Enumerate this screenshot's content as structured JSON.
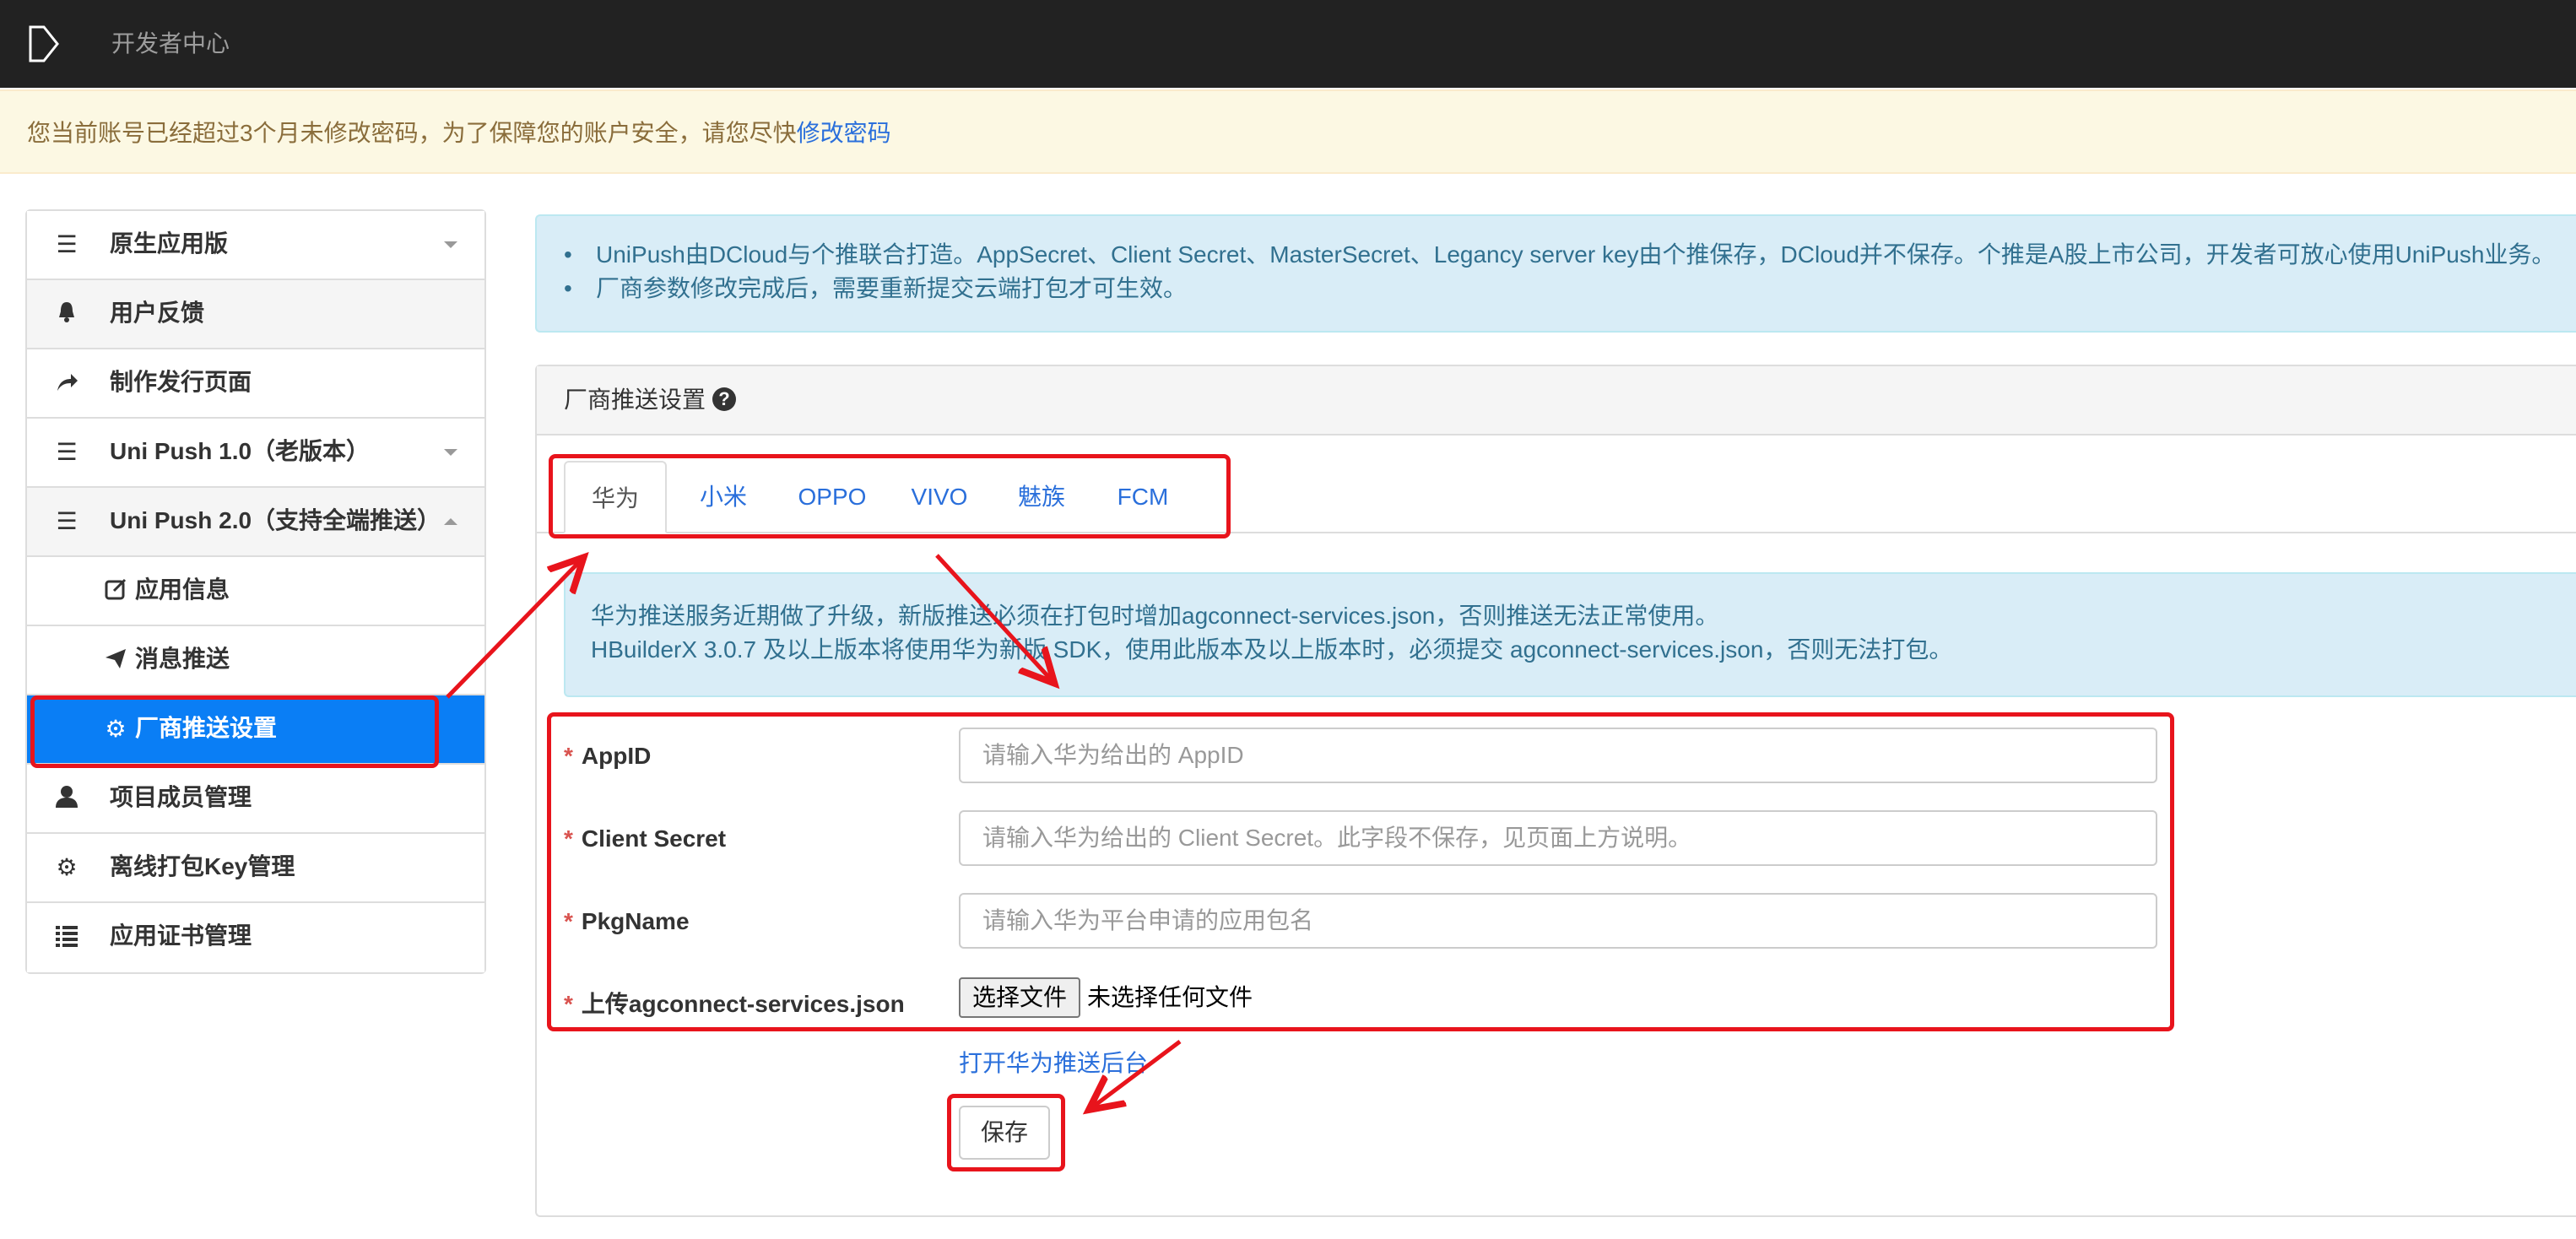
{
  "navbar": {
    "title": "开发者中心"
  },
  "warning": {
    "text": "您当前账号已经超过3个月未修改密码，为了保障您的账户安全，请您尽快",
    "link": "修改密码"
  },
  "sidebar": {
    "items": [
      {
        "label": "原生应用版",
        "icon": "menu-icon"
      },
      {
        "label": "用户反馈",
        "icon": "bell-icon"
      },
      {
        "label": "制作发行页面",
        "icon": "share-arrow-icon"
      },
      {
        "label": "Uni Push 1.0（老版本）",
        "icon": "menu-icon"
      },
      {
        "label": "Uni Push 2.0（支持全端推送）",
        "icon": "menu-icon"
      },
      {
        "label": "应用信息",
        "icon": "edit-icon"
      },
      {
        "label": "消息推送",
        "icon": "send-icon"
      },
      {
        "label": "厂商推送设置",
        "icon": "gear-icon",
        "active": true
      },
      {
        "label": "项目成员管理",
        "icon": "user-icon"
      },
      {
        "label": "离线打包Key管理",
        "icon": "gear-icon"
      },
      {
        "label": "应用证书管理",
        "icon": "list-icon"
      }
    ]
  },
  "info": {
    "items": [
      "UniPush由DCloud与个推联合打造。AppSecret、Client Secret、MasterSecret、Legancy server key由个推保存，DCloud并不保存。个推是A股上市公司，开发者可放心使用UniPush业务。",
      "厂商参数修改完成后，需要重新提交云端打包才可生效。"
    ]
  },
  "panel": {
    "title": "厂商推送设置",
    "tabs": [
      "华为",
      "小米",
      "OPPO",
      "VIVO",
      "魅族",
      "FCM"
    ],
    "active_tab": "华为",
    "notice": [
      "华为推送服务近期做了升级，新版推送必须在打包时增加agconnect-services.json，否则推送无法正常使用。",
      "HBuilderX 3.0.7 及以上版本将使用华为新版 SDK，使用此版本及以上版本时，必须提交 agconnect-services.json，否则无法打包。"
    ],
    "form": {
      "appid_label": "AppID",
      "appid_placeholder": "请输入华为给出的 AppID",
      "secret_label": "Client Secret",
      "secret_placeholder": "请输入华为给出的 Client Secret。此字段不保存，见页面上方说明。",
      "pkg_label": "PkgName",
      "pkg_placeholder": "请输入华为平台申请的应用包名",
      "upload_label": "上传agconnect-services.json",
      "file_button": "选择文件",
      "file_status": "未选择任何文件",
      "required_mark": "*"
    },
    "open_link": "打开华为推送后台",
    "save_button": "保存"
  },
  "colors": {
    "navbar": "#222222",
    "warning_bg": "#fcf8e3",
    "info_bg": "#d9edf7",
    "active": "#0a7ef5",
    "annotation": "#e8141c",
    "link": "#2a6fdb"
  }
}
